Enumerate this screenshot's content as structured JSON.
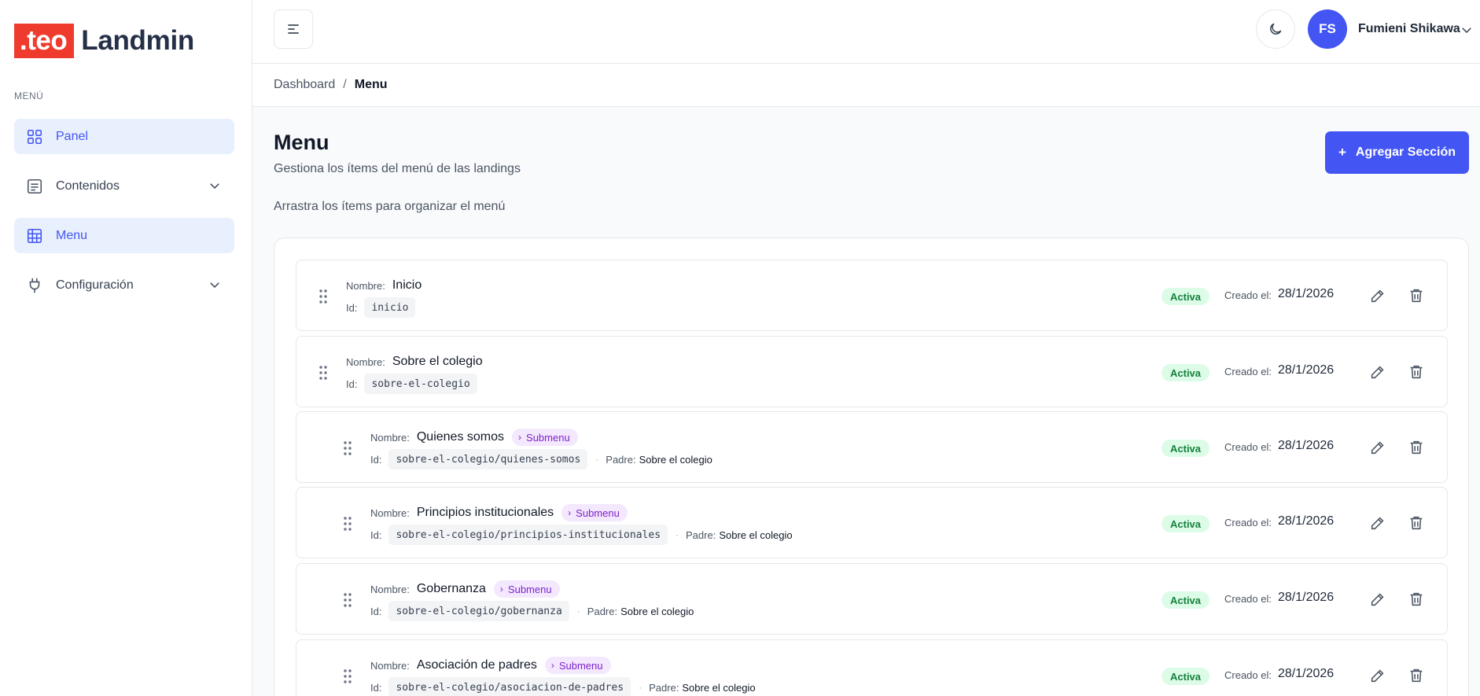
{
  "logo": {
    "mark": ".teo",
    "text": "Landmin"
  },
  "sidebar": {
    "section_label": "MENÚ",
    "items": [
      {
        "label": "Panel",
        "icon": "grid-icon",
        "active": true
      },
      {
        "label": "Contenidos",
        "icon": "document-icon",
        "active": false,
        "expandable": true
      },
      {
        "label": "Menu",
        "icon": "table-icon",
        "active": true
      },
      {
        "label": "Configuración",
        "icon": "plug-icon",
        "active": false,
        "expandable": true
      }
    ]
  },
  "header": {
    "user_initials": "FS",
    "user_name": "Fumieni Shikawa"
  },
  "breadcrumb": {
    "parent": "Dashboard",
    "separator": "/",
    "current": "Menu"
  },
  "page": {
    "title": "Menu",
    "subtitle": "Gestiona los ítems del menú de las landings",
    "hint": "Arrastra los ítems para organizar el menú",
    "add_button": "Agregar Sección"
  },
  "labels": {
    "nombre": "Nombre:",
    "id": "Id:",
    "padre": "Padre:",
    "submenu": "Submenu",
    "creado": "Creado el:"
  },
  "items": [
    {
      "name": "Inicio",
      "id": "inicio",
      "status": "Activa",
      "created": "28/1/2026",
      "submenu": false
    },
    {
      "name": "Sobre el colegio",
      "id": "sobre-el-colegio",
      "status": "Activa",
      "created": "28/1/2026",
      "submenu": false
    },
    {
      "name": "Quienes somos",
      "id": "sobre-el-colegio/quienes-somos",
      "status": "Activa",
      "created": "28/1/2026",
      "submenu": true,
      "parent": "Sobre el colegio"
    },
    {
      "name": "Principios institucionales",
      "id": "sobre-el-colegio/principios-institucionales",
      "status": "Activa",
      "created": "28/1/2026",
      "submenu": true,
      "parent": "Sobre el colegio"
    },
    {
      "name": "Gobernanza",
      "id": "sobre-el-colegio/gobernanza",
      "status": "Activa",
      "created": "28/1/2026",
      "submenu": true,
      "parent": "Sobre el colegio"
    },
    {
      "name": "Asociación de padres",
      "id": "sobre-el-colegio/asociacion-de-padres",
      "status": "Activa",
      "created": "28/1/2026",
      "submenu": true,
      "parent": "Sobre el colegio"
    }
  ],
  "colors": {
    "accent": "#4356f3",
    "brand_red": "#ef3b2d",
    "status_green": "#15803d",
    "submenu_purple": "#7e22ce"
  }
}
